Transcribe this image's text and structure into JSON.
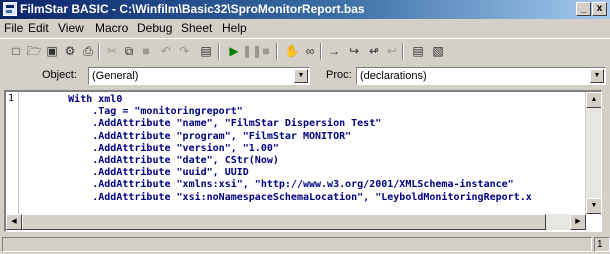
{
  "window": {
    "title": "FilmStar BASIC - C:\\Winfilm\\Basic32\\SproMonitorReport.bas",
    "min_label": "_",
    "close_label": "x"
  },
  "menu": [
    "File",
    "Edit",
    "View",
    "Macro",
    "Debug",
    "Sheet",
    "Help"
  ],
  "selectors": {
    "object_label": "Object:",
    "object_value": "(General)",
    "proc_label": "Proc:",
    "proc_value": "(declarations)"
  },
  "editor": {
    "line_number": "1",
    "lines": [
      "        With xml0",
      "            .Tag = \"monitoringreport\"",
      "            .AddAttribute \"name\", \"FilmStar Dispersion Test\"",
      "            .AddAttribute \"program\", \"FilmStar MONITOR\"",
      "            .AddAttribute \"version\", \"1.00\"",
      "            .AddAttribute \"date\", CStr(Now)",
      "            .AddAttribute \"uuid\", UUID",
      "            .AddAttribute \"xmlns:xsi\", \"http://www.w3.org/2001/XMLSchema-instance\"",
      "            .AddAttribute \"xsi:noNamespaceSchemaLocation\", \"LeyboldMonitoringReport.x"
    ]
  },
  "status": {
    "main": "",
    "right": "1"
  },
  "colors": {
    "title_start": "#0a246a",
    "title_end": "#a6caf0",
    "code_text": "#000080",
    "chrome": "#d4d0c8"
  },
  "icons": [
    "new-file-icon",
    "open-folder-icon",
    "save-icon",
    "run-icon",
    "print-icon",
    "cut-icon",
    "copy-icon",
    "paste-icon",
    "undo-icon",
    "redo-icon",
    "dialog-editor-icon",
    "start-icon",
    "pause-icon",
    "stop-icon",
    "toggle-breakpoint-icon",
    "quick-watch-icon",
    "step-into-icon",
    "step-over-icon",
    "step-out-icon",
    "immediate-window-icon",
    "window-icon"
  ]
}
